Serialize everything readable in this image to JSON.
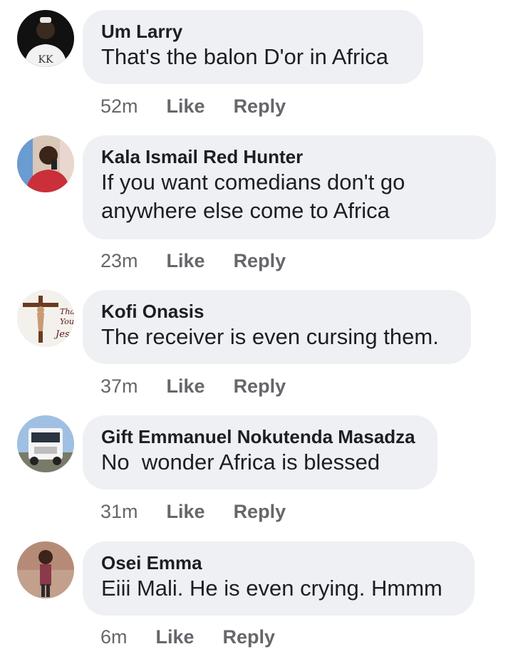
{
  "comments": [
    {
      "author": "Um Larry",
      "text": "That's the balon D'or in Africa",
      "time": "52m",
      "like_label": "Like",
      "reply_label": "Reply",
      "avatar_icon": "profile-photo-man-dark-shirt"
    },
    {
      "author": "Kala Ismail Red Hunter",
      "text": "If you want comedians don't go\nanywhere else come to Africa",
      "time": "23m",
      "like_label": "Like",
      "reply_label": "Reply",
      "avatar_icon": "profile-photo-man-red-shirt-selfie"
    },
    {
      "author": "Kofi Onasis",
      "text": "The receiver is even cursing them.",
      "time": "37m",
      "like_label": "Like",
      "reply_label": "Reply",
      "avatar_icon": "profile-photo-crucifix-thank-you-jesus"
    },
    {
      "author": "Gift Emmanuel Nokutenda Masadza",
      "text": "No  wonder Africa is blessed",
      "time": "31m",
      "like_label": "Like",
      "reply_label": "Reply",
      "avatar_icon": "profile-photo-white-truck"
    },
    {
      "author": "Osei Emma",
      "text": "Eiii Mali. He is even crying. Hmmm",
      "time": "6m",
      "like_label": "Like",
      "reply_label": "Reply",
      "avatar_icon": "profile-photo-man-standing-indoors"
    }
  ],
  "colors": {
    "bubble_background": "#eef0f3",
    "meta_text": "#65676b",
    "primary_text": "#1c1e21"
  }
}
